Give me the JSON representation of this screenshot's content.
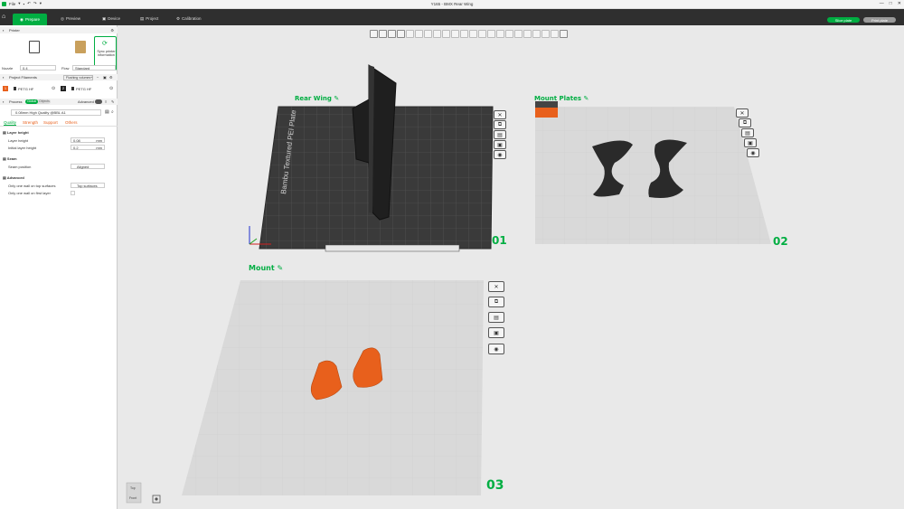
{
  "window": {
    "title": "Y165 - BMX Rear Wing",
    "file_menu": "File"
  },
  "menubar": {
    "tabs": [
      "Prepare",
      "Preview",
      "Device",
      "Project",
      "Calibration"
    ],
    "slice_now": "Slice plate",
    "print_plate": "Print plate"
  },
  "printer": {
    "section_title": "Printer",
    "printer_name": "Bambu Lab A1",
    "plate_name": "Textured...",
    "sync_label": "Sync printer information",
    "nozzle_label": "Nozzle",
    "nozzle_value": "0.4",
    "flow_label": "Flow",
    "flow_value": "Standard"
  },
  "filaments": {
    "section_title": "Project Filaments",
    "flushing_label": "Flushing volumes",
    "items": [
      {
        "num": "1",
        "name": "PETG HF",
        "color": "#e8601c"
      },
      {
        "num": "2",
        "name": "PETG HF",
        "color": "#222222"
      }
    ]
  },
  "process": {
    "section_title": "Process",
    "global_label": "Global",
    "objects_label": "Objects",
    "advanced_label": "Advanced",
    "preset": "0.08mm High Quality @BBL A1",
    "tabs": [
      "Quality",
      "Strength",
      "Support",
      "Others"
    ]
  },
  "quality": {
    "layer_height_title": "Layer height",
    "layer_height_label": "Layer height",
    "layer_height_value": "0.08",
    "layer_height_unit": "mm",
    "initial_layer_label": "Initial layer height",
    "initial_layer_value": "0.2",
    "initial_layer_unit": "mm",
    "seam_title": "Seam",
    "seam_position_label": "Seam position",
    "seam_position_value": "Aligned",
    "advanced_title": "Advanced",
    "one_wall_top_label": "Only one wall on top surfaces",
    "one_wall_top_value": "Top surfaces",
    "one_wall_first_label": "Only one wall on first layer"
  },
  "plates": [
    {
      "name": "Rear Wing",
      "num": "01"
    },
    {
      "name": "Mount Plates",
      "num": "02"
    },
    {
      "name": "Mount",
      "num": "03"
    }
  ],
  "build_plate_text": "Bambu Textured PEI Plate",
  "view_cube": {
    "top": "Top",
    "front": "Front"
  },
  "colors": {
    "accent": "#00ae42",
    "orange": "#e8601c",
    "dark_part": "#2a2a2a"
  }
}
